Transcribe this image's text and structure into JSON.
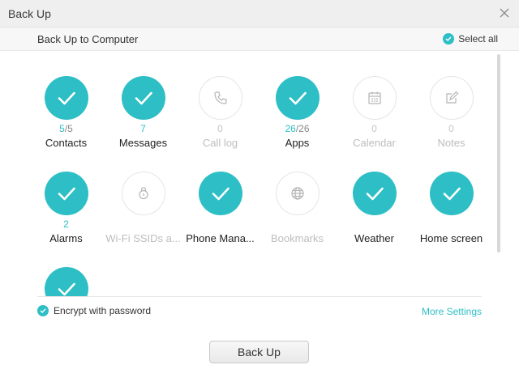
{
  "window": {
    "title": "Back Up"
  },
  "header": {
    "subtitle": "Back Up to Computer",
    "select_all_label": "Select all"
  },
  "colors": {
    "accent": "#2dbfc5",
    "disabled": "#c6c6c6"
  },
  "items": [
    {
      "name": "contacts",
      "label": "Contacts",
      "checked": true,
      "enabled": true,
      "count_current": "5",
      "count_total": "/5",
      "icon": "check-icon"
    },
    {
      "name": "messages",
      "label": "Messages",
      "checked": true,
      "enabled": true,
      "count_current": "7",
      "count_total": "",
      "icon": "check-icon"
    },
    {
      "name": "call-log",
      "label": "Call log",
      "checked": false,
      "enabled": false,
      "count_current": "0",
      "count_total": "",
      "icon": "phone-icon"
    },
    {
      "name": "apps",
      "label": "Apps",
      "checked": true,
      "enabled": true,
      "count_current": "26",
      "count_total": "/26",
      "icon": "check-icon"
    },
    {
      "name": "calendar",
      "label": "Calendar",
      "checked": false,
      "enabled": false,
      "count_current": "0",
      "count_total": "",
      "icon": "calendar-icon"
    },
    {
      "name": "notes",
      "label": "Notes",
      "checked": false,
      "enabled": false,
      "count_current": "0",
      "count_total": "",
      "icon": "notes-icon"
    },
    {
      "name": "alarms",
      "label": "Alarms",
      "checked": true,
      "enabled": true,
      "count_current": "2",
      "count_total": "",
      "icon": "check-icon"
    },
    {
      "name": "wifi-ssids",
      "label": "Wi-Fi SSIDs a...",
      "checked": false,
      "enabled": false,
      "count_current": "",
      "count_total": "",
      "icon": "lock-icon"
    },
    {
      "name": "phone-manager",
      "label": "Phone Mana...",
      "checked": true,
      "enabled": true,
      "count_current": "",
      "count_total": "",
      "icon": "check-icon"
    },
    {
      "name": "bookmarks",
      "label": "Bookmarks",
      "checked": false,
      "enabled": false,
      "count_current": "",
      "count_total": "",
      "icon": "globe-icon"
    },
    {
      "name": "weather",
      "label": "Weather",
      "checked": true,
      "enabled": true,
      "count_current": "",
      "count_total": "",
      "icon": "check-icon"
    },
    {
      "name": "home-screen",
      "label": "Home screen",
      "checked": true,
      "enabled": true,
      "count_current": "",
      "count_total": "",
      "icon": "check-icon"
    },
    {
      "name": "extra",
      "label": "",
      "checked": true,
      "enabled": true,
      "count_current": "",
      "count_total": "",
      "icon": "check-icon"
    }
  ],
  "footer": {
    "encrypt_label": "Encrypt with password",
    "encrypt_checked": true,
    "more_settings_label": "More Settings",
    "backup_button": "Back Up"
  }
}
